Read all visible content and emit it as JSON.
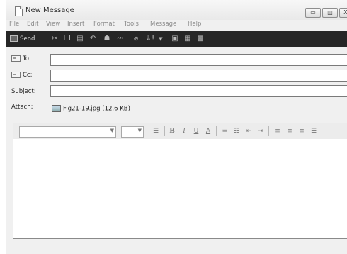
{
  "window": {
    "title": "New Message"
  },
  "window_controls": {
    "minimize": "▭",
    "maximize": "◫",
    "close": "X"
  },
  "menu": [
    "File",
    "Edit",
    "View",
    "Insert",
    "Format",
    "Tools",
    "Message",
    "Help"
  ],
  "toolbar": {
    "send_label": "Send",
    "icons": [
      "cut-icon",
      "copy-icon",
      "paste-icon",
      "undo-icon",
      "check-names-icon",
      "spelling-icon",
      "attach-icon",
      "priority-icon",
      "priority-dropdown-icon",
      "sign-icon",
      "encrypt-icon",
      "offline-icon"
    ]
  },
  "fields": {
    "to_label": "To:",
    "cc_label": "Cc:",
    "subject_label": "Subject:",
    "attach_label": "Attach:",
    "to_value": "",
    "cc_value": "",
    "subject_value": ""
  },
  "attachment": {
    "name": "Fig21-19.jpg (12.6 KB)"
  },
  "format_toolbar": {
    "font_name": "",
    "font_size": "",
    "icons": [
      "paragraph-style-icon",
      "bold-icon",
      "italic-icon",
      "underline-icon",
      "font-color-icon",
      "numbered-list-icon",
      "bulleted-list-icon",
      "decrease-indent-icon",
      "increase-indent-icon",
      "align-left-icon",
      "align-center-icon",
      "align-right-icon",
      "justify-icon"
    ]
  },
  "body": {
    "text": ""
  },
  "status": {
    "text": ""
  }
}
